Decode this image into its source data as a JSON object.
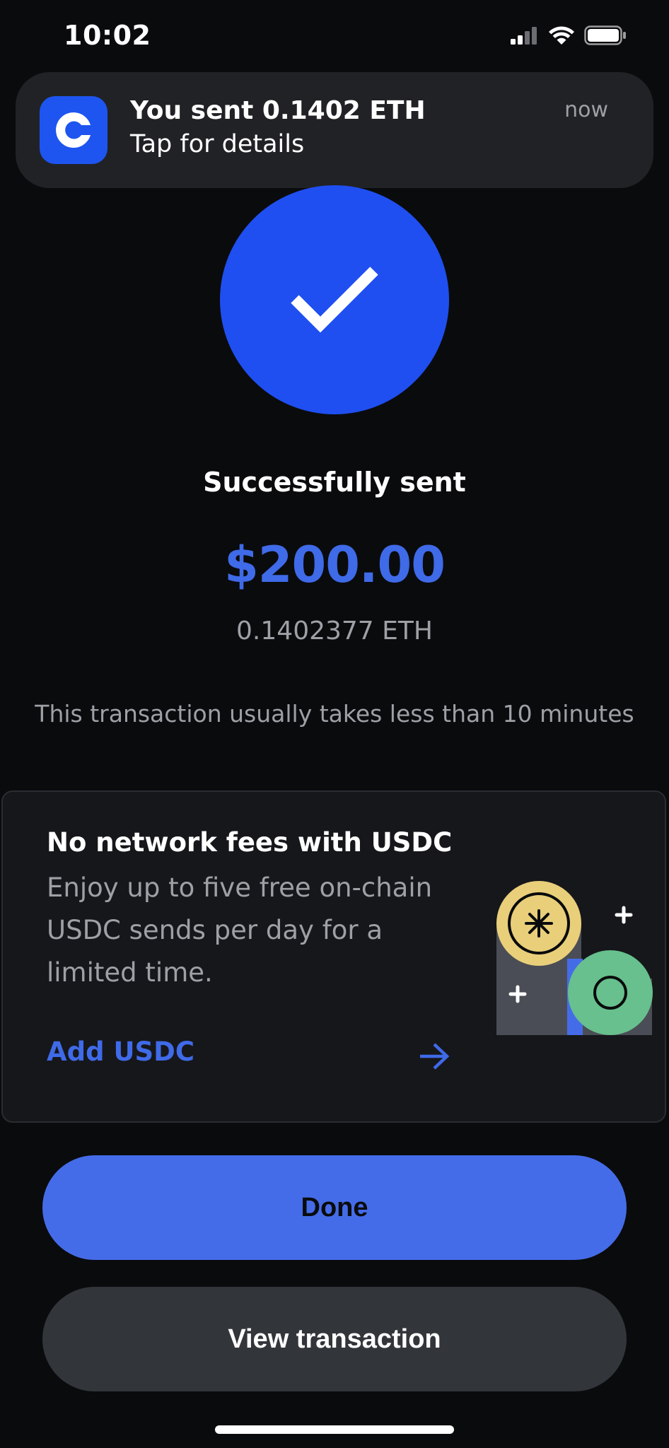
{
  "status_bar": {
    "time": "10:02"
  },
  "notification": {
    "app_icon": "coinbase-logo-icon",
    "title": "You sent 0.1402 ETH",
    "subtitle": "Tap for details",
    "time": "now"
  },
  "success": {
    "icon": "checkmark-icon",
    "title": "Successfully sent",
    "amount_fiat": "$200.00",
    "amount_crypto": "0.1402377 ETH",
    "note": "This transaction usually takes less than 10 minutes"
  },
  "promo": {
    "title": "No network fees with USDC",
    "body": "Enjoy up to five free on-chain USDC sends per day for a limited time.",
    "cta_label": "Add USDC",
    "cta_icon": "arrow-right-icon"
  },
  "buttons": {
    "done_label": "Done",
    "view_label": "View transaction"
  },
  "colors": {
    "accent": "#3f6ae8",
    "success_circle": "#1f4ff0",
    "background": "#0a0b0d"
  }
}
